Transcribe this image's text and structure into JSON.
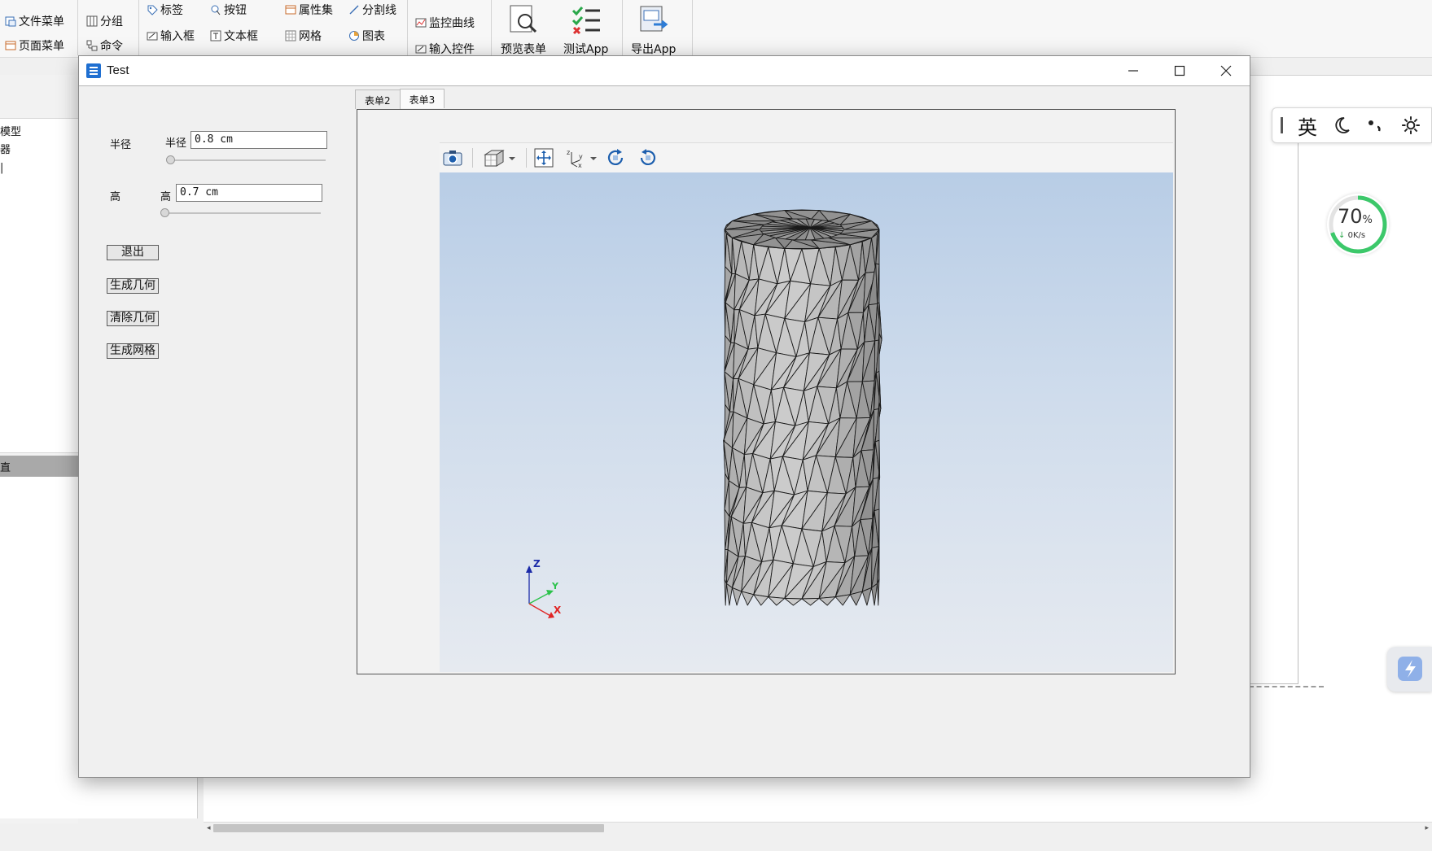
{
  "ribbon": {
    "file_menu": "文件菜单",
    "page_menu": "页面菜单",
    "group": "分组",
    "command": "命令",
    "label": "标签",
    "button": "按钮",
    "input_box": "输入框",
    "text_box": "文本框",
    "property_set": "属性集",
    "separator": "分割线",
    "grid": "网格",
    "chart": "图表",
    "monitor_curve": "监控曲线",
    "input_control": "输入控件",
    "preview_form": "预览表单",
    "test_app": "测试App",
    "export_app": "导出App"
  },
  "background": {
    "tree_items": [
      "模型",
      "器",
      "|"
    ],
    "band_text": "直"
  },
  "ime": {
    "lang": "英"
  },
  "speed": {
    "percent": "70",
    "unit": "%",
    "rate": "0K/s"
  },
  "window": {
    "title": "Test"
  },
  "form": {
    "radius_label": "半径",
    "radius_field_label": "半径",
    "radius_value": "0.8 cm",
    "height_label": "高",
    "height_field_label": "高",
    "height_value": "0.7 cm",
    "exit_button": "退出",
    "generate_geometry_button": "生成几何",
    "clear_geometry_button": "清除几何",
    "generate_mesh_button": "生成网格"
  },
  "tabs": [
    {
      "label": "表单2",
      "active": false
    },
    {
      "label": "表单3",
      "active": true
    }
  ],
  "axes": {
    "z": "Z",
    "y": "Y",
    "x": "X"
  },
  "colors": {
    "mesh_fill": "#a8a8a8",
    "mesh_edge": "#1a1a1a",
    "accent_green": "#3cc86a",
    "title_icon": "#1f6fd1"
  }
}
